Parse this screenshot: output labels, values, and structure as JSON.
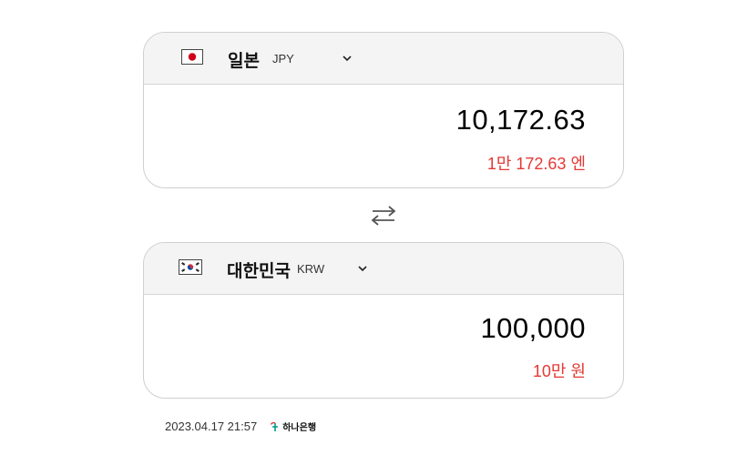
{
  "from": {
    "country": "일본",
    "code": "JPY",
    "amount": "10,172.63",
    "amount_words": "1만 172.63 엔",
    "flag": "japan-flag-icon"
  },
  "to": {
    "country": "대한민국",
    "code": "KRW",
    "amount": "100,000",
    "amount_words": "10만 원",
    "flag": "korea-flag-icon"
  },
  "footer": {
    "timestamp": "2023.04.17 21:57",
    "bank_name": "하나은행",
    "bank_logo": "hana-bank-logo-icon"
  },
  "colors": {
    "accent_red": "#e53935",
    "header_bg": "#f4f4f4",
    "border": "#cfcfcf",
    "bank_green": "#009a8a"
  },
  "icons": {
    "swap": "swap-arrows-icon",
    "dropdown": "chevron-down-icon"
  }
}
